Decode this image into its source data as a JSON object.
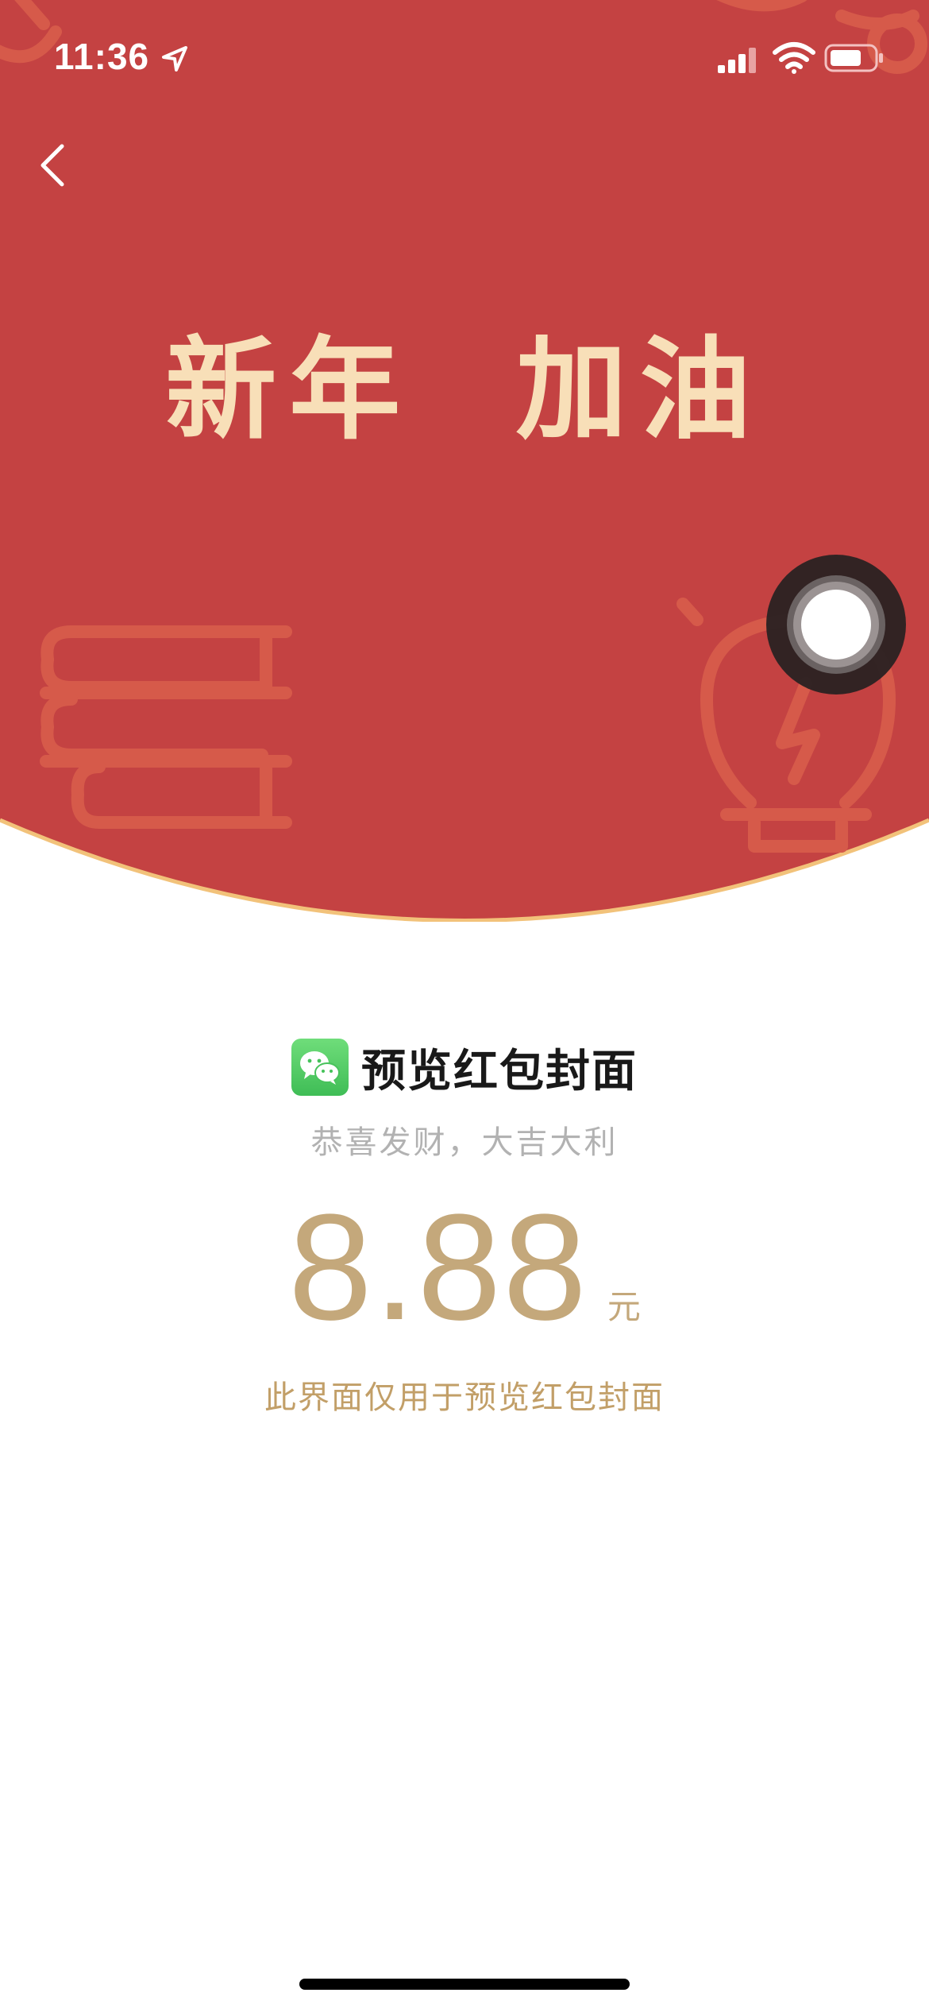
{
  "status_bar": {
    "time": "11:36",
    "icons": [
      "location-arrow-icon",
      "cellular-signal-icon",
      "wifi-icon",
      "battery-icon"
    ]
  },
  "navigation": {
    "back_icon": "chevron-left-icon"
  },
  "cover": {
    "title": "新年  加油",
    "background_color": "#c44242",
    "decoration_color": "#d65a4a",
    "rim_color": "#f2c27a",
    "title_color": "#f8dfb8",
    "decorations": [
      "books-icon",
      "lightbulb-icon"
    ]
  },
  "envelope": {
    "sender_icon": "wechat-icon",
    "sender_name": "预览红包封面",
    "blessing": "恭喜发财，大吉大利",
    "amount": "8.88",
    "currency_unit": "元",
    "note": "此界面仅用于预览红包封面",
    "amount_color": "#c4a87b"
  },
  "assistive_touch": {
    "icon": "assistive-touch-icon"
  }
}
